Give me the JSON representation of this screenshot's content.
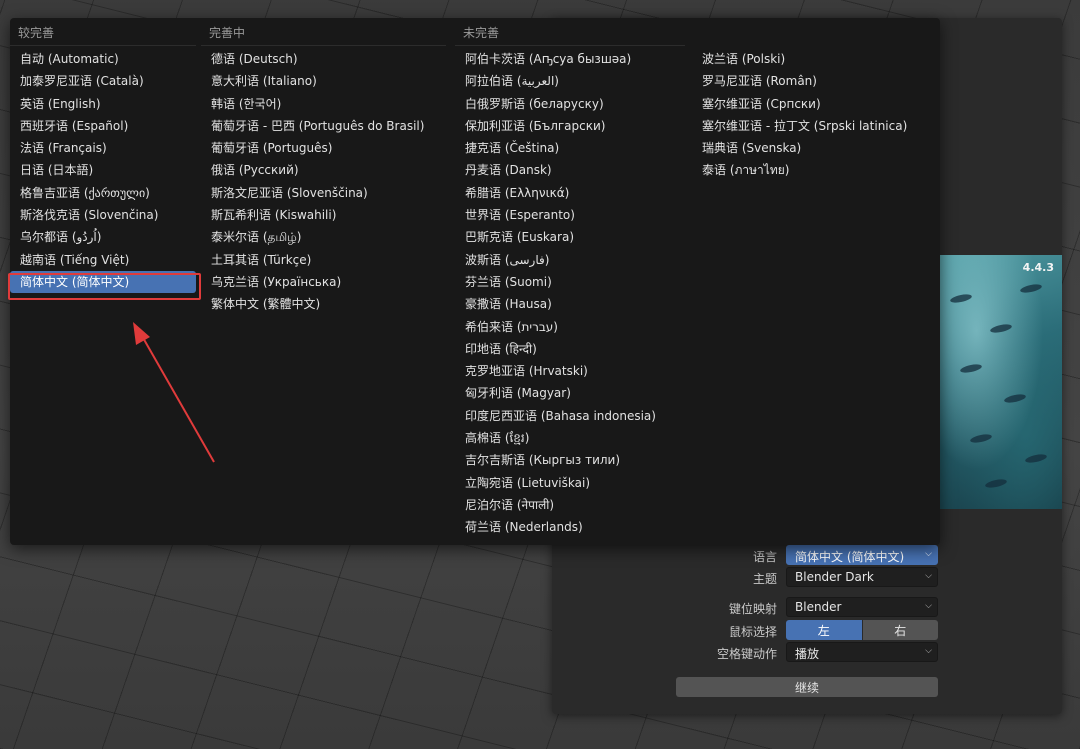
{
  "splash": {
    "version": "4.4.3"
  },
  "settings": {
    "language_label": "语言",
    "language_value": "简体中文 (简体中文)",
    "theme_label": "主题",
    "theme_value": "Blender Dark",
    "keymap_label": "键位映射",
    "keymap_value": "Blender",
    "mouse_label": "鼠标选择",
    "mouse_left": "左",
    "mouse_right": "右",
    "spacebar_label": "空格键动作",
    "spacebar_value": "播放",
    "continue_label": "继续"
  },
  "menu": {
    "columns": [
      {
        "heading": "较完善",
        "items": [
          "自动 (Automatic)",
          "加泰罗尼亚语 (Català)",
          "英语 (English)",
          "西班牙语 (Español)",
          "法语 (Français)",
          "日语 (日本語)",
          "格鲁吉亚语 (ქართული)",
          "斯洛伐克语 (Slovenčina)",
          "乌尔都语 (اُردُو)",
          "越南语 (Tiếng Việt)",
          "简体中文 (简体中文)"
        ]
      },
      {
        "heading": "完善中",
        "items": [
          "德语 (Deutsch)",
          "意大利语 (Italiano)",
          "韩语 (한국어)",
          "葡萄牙语 - 巴西 (Português do Brasil)",
          "葡萄牙语 (Português)",
          "俄语 (Русский)",
          "斯洛文尼亚语 (Slovenščina)",
          "斯瓦希利语 (Kiswahili)",
          "泰米尔语 (தமிழ்)",
          "土耳其语 (Türkçe)",
          "乌克兰语 (Українська)",
          "繁体中文 (繁體中文)"
        ]
      },
      {
        "heading": "未完善",
        "items": [
          "阿伯卡茨语 (Аҧсуа бызшәа)",
          "阿拉伯语 (العربية)",
          "白俄罗斯语 (беларуску)",
          "保加利亚语 (Български)",
          "捷克语 (Čeština)",
          "丹麦语 (Dansk)",
          "希腊语 (Ελληνικά)",
          "世界语 (Esperanto)",
          "巴斯克语 (Euskara)",
          "波斯语 (فارسی)",
          "芬兰语 (Suomi)",
          "豪撒语 (Hausa)",
          "希伯来语 (עברית)",
          "印地语 (हिन्दी)",
          "克罗地亚语 (Hrvatski)",
          "匈牙利语 (Magyar)",
          "印度尼西亚语 (Bahasa indonesia)",
          "高棉语 (ខ្មែរ)",
          "吉尔吉斯语 (Кыргыз тили)",
          "立陶宛语 (Lietuviškai)",
          "尼泊尔语 (नेपाली)",
          "荷兰语 (Nederlands)"
        ]
      },
      {
        "heading": "",
        "items": [
          "波兰语 (Polski)",
          "罗马尼亚语 (Român)",
          "塞尔维亚语 (Српски)",
          "塞尔维亚语 - 拉丁文 (Srpski latinica)",
          "瑞典语 (Svenska)",
          "泰语 (ภาษาไทย)"
        ]
      }
    ],
    "selected": "简体中文 (简体中文)"
  },
  "colors": {
    "accent": "#4772b3",
    "annotation": "#e03b3b",
    "menu_bg": "#181818"
  }
}
